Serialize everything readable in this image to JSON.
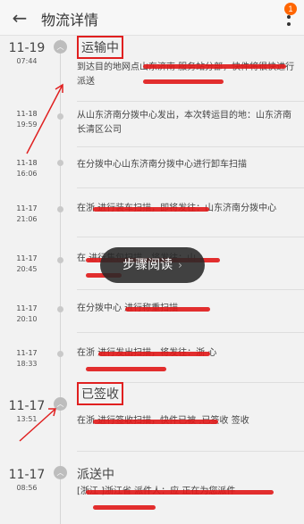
{
  "header": {
    "back_icon": "arrow-left-icon",
    "title": "物流详情",
    "more_icon": "more-vertical-icon",
    "badge_count": "1"
  },
  "overlay": {
    "reading_button": "步骤阅读",
    "reading_chevron": "›"
  },
  "annotation_color": "#e02020",
  "entries": [
    {
      "date": "11-19",
      "time": "07:44",
      "status": "运输中",
      "node_icon": "chevron-up-icon",
      "desc": "到达目的地网点山东济南 服务站分部，快件将很快进行派送"
    },
    {
      "date": "11-18",
      "time": "19:59",
      "desc": "从山东济南分拨中心发出，本次转运目的地：山东济南长清区公司"
    },
    {
      "date": "11-18",
      "time": "16:06",
      "desc": "在分拨中心山东济南分拨中心进行卸车扫描"
    },
    {
      "date": "11-17",
      "time": "21:06",
      "desc": "在浙 进行装车扫描，即将发往：山东济南分拨中心"
    },
    {
      "date": "11-17",
      "time": "20:45",
      "desc": "在 进行集包扫描，将发往：山"
    },
    {
      "date": "11-17",
      "time": "20:10",
      "desc": "在分拨中心 进行称重扫描"
    },
    {
      "date": "11-17",
      "time": "18:33",
      "desc": "在浙 进行发出扫描，将发往：浙 心"
    },
    {
      "date": "11-17",
      "time": "13:51",
      "status": "已签收",
      "node_icon": "chevron-up-icon",
      "desc": "在浙 进行签收扫描，快件已被 ,已签收 签收"
    },
    {
      "date": "11-17",
      "time": "08:56",
      "status": "派送中",
      "node_icon": "chevron-up-icon",
      "desc": "[浙江 ]浙江省 派件人：应 正在为您派件"
    }
  ]
}
